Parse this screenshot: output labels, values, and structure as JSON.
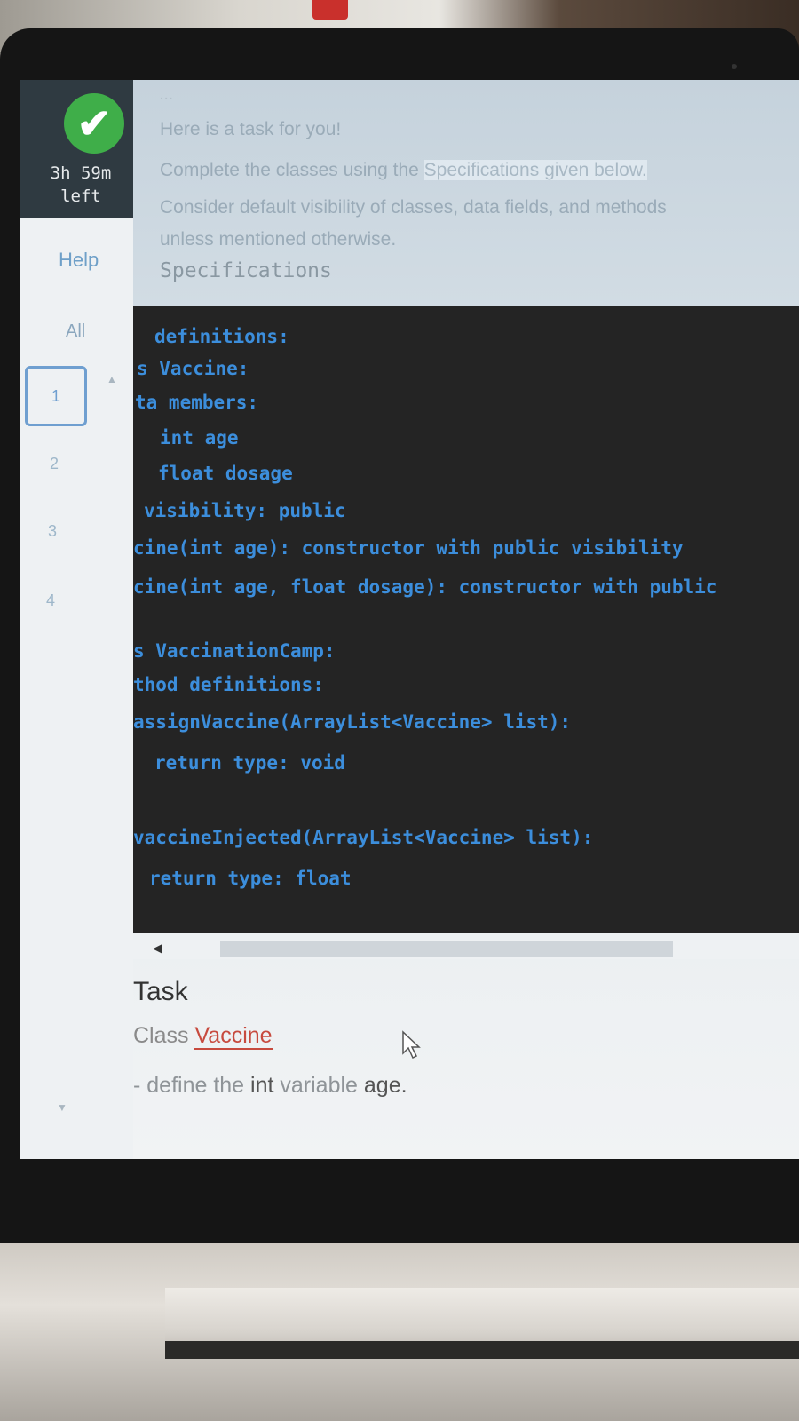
{
  "timer": {
    "line1": "3h 59m",
    "line2": "left"
  },
  "nav": {
    "help": "Help",
    "all": "All",
    "questions": [
      "1",
      "2",
      "3",
      "4"
    ],
    "active_index": 0
  },
  "intro": {
    "cut_line": "...",
    "line1": "Here is a task for you!",
    "line2_pre": "Complete the classes using the ",
    "line2_link": "Specifications given below.",
    "line3": "Consider default visibility of classes, data fields, and methods",
    "line4": "unless mentioned otherwise."
  },
  "spec_heading": "Specifications",
  "code": {
    "l1": "definitions:",
    "l2": "s Vaccine:",
    "l3": "ta members:",
    "l4": "int age",
    "l5": "float dosage",
    "l6": "visibility: public",
    "l7": "cine(int age): constructor with public visibility",
    "l8": "cine(int age, float dosage): constructor with public",
    "l9": "s VaccinationCamp:",
    "l10": "thod definitions:",
    "l11": "assignVaccine(ArrayList<Vaccine> list):",
    "l12": "return type: void",
    "l13": "vaccineInjected(ArrayList<Vaccine> list):",
    "l14": "return type: float"
  },
  "task": {
    "title": "Task",
    "class_prefix": "Class ",
    "class_name": "Vaccine",
    "define_pre": "- define the ",
    "define_kw": "int",
    "define_mid": " variable ",
    "define_var": "age."
  },
  "icons": {
    "status": "check-icon",
    "scroll_left": "chevron-left-icon",
    "scroll_up": "chevron-up-icon",
    "scroll_down": "chevron-down-icon",
    "pointer": "mouse-cursor-icon"
  },
  "colors": {
    "timer_bg": "#2f3a41",
    "check": "#3fae49",
    "code_bg": "#242424",
    "code_text": "#3c8edc",
    "link_red": "#c74a3e"
  }
}
